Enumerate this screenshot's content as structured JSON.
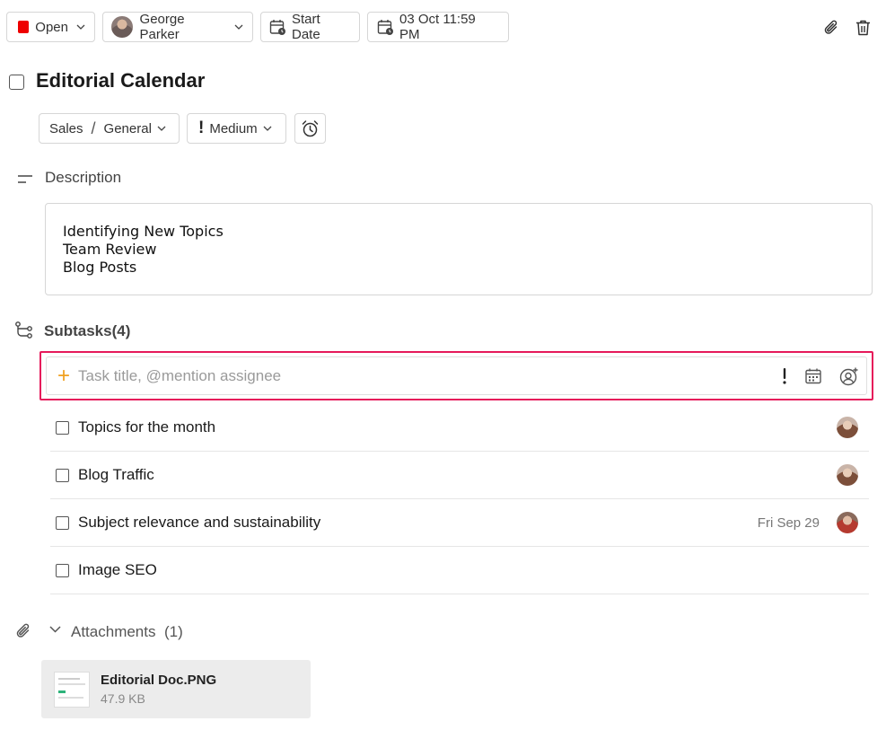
{
  "toolbar": {
    "status": {
      "label": "Open",
      "color": "#ee0000"
    },
    "assignee": {
      "name": "George Parker"
    },
    "start_date": {
      "label": "Start Date"
    },
    "due_date": {
      "label": "03 Oct 11:59 PM"
    },
    "icons": [
      "paperclip-icon",
      "trash-icon"
    ]
  },
  "task": {
    "title": "Editorial Calendar",
    "project": "Sales",
    "section": "General",
    "priority": "Medium"
  },
  "description": {
    "label": "Description",
    "lines": [
      "Identifying New Topics",
      "Team Review",
      "Blog Posts"
    ]
  },
  "subtasks": {
    "label": "Subtasks",
    "count": "(4)",
    "input_placeholder": "Task title, @mention assignee",
    "items": [
      {
        "title": "Topics for the month",
        "date": ""
      },
      {
        "title": "Blog Traffic",
        "date": ""
      },
      {
        "title": "Subject relevance and sustainability",
        "date": "Fri Sep 29"
      },
      {
        "title": "Image SEO",
        "date": ""
      }
    ]
  },
  "attachments": {
    "label": "Attachments",
    "count": "(1)",
    "files": [
      {
        "name": "Editorial Doc.PNG",
        "size": "47.9 KB"
      }
    ]
  },
  "colors": {
    "accent_border": "#e6195a",
    "plus": "#f0a020",
    "status_open": "#ee0000"
  }
}
